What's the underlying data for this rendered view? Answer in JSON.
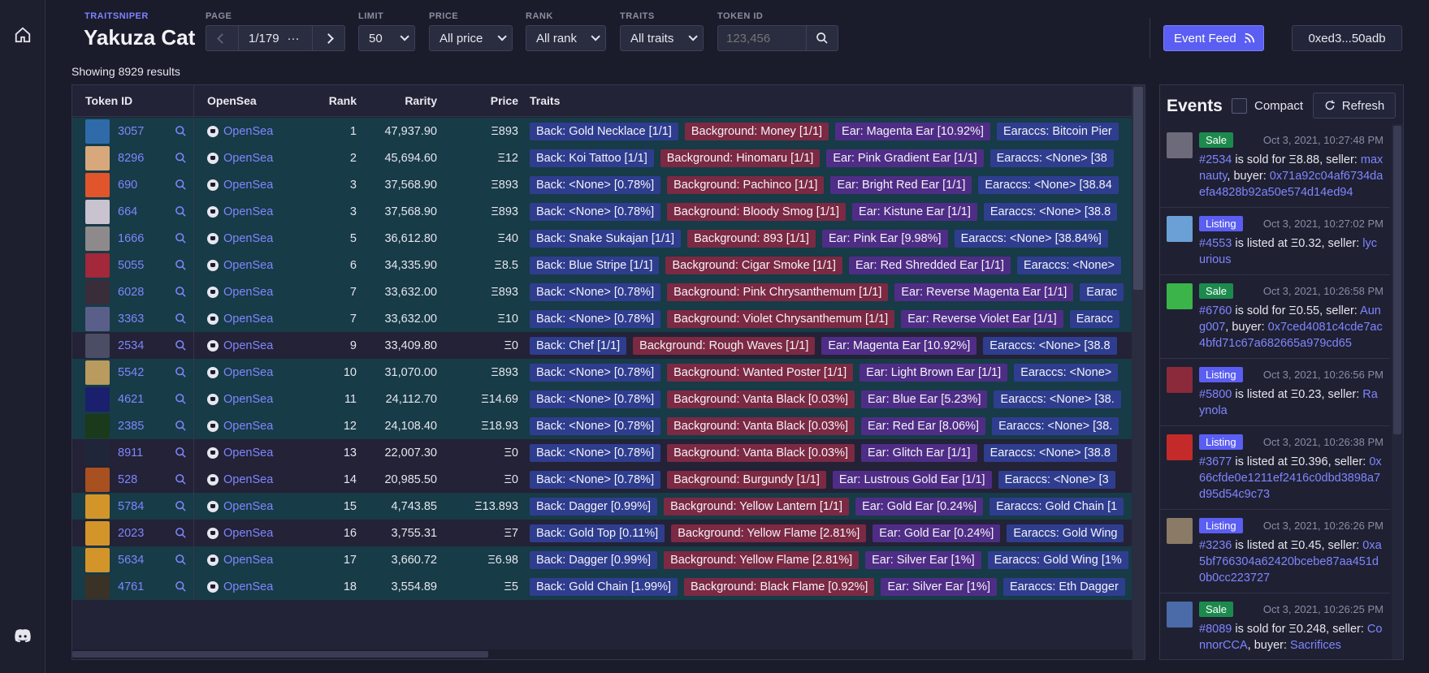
{
  "header": {
    "brand_sub": "TRAITSNIPER",
    "collection": "Yakuza Cat",
    "page_label": "PAGE",
    "page_value": "1/179",
    "page_more": "···",
    "limit_label": "LIMIT",
    "limit_value": "50",
    "price_label": "PRICE",
    "price_value": "All price",
    "rank_label": "RANK",
    "rank_value": "All rank",
    "traits_label": "TRAITS",
    "traits_value": "All traits",
    "token_label": "TOKEN ID",
    "token_placeholder": "123,456",
    "event_feed": "Event Feed",
    "wallet": "0xed3...50adb"
  },
  "results_text": "Showing 8929 results",
  "table": {
    "columns": [
      "Token ID",
      "OpenSea",
      "Rank",
      "Rarity",
      "Price",
      "Traits"
    ],
    "opensea_label": "OpenSea",
    "rows": [
      {
        "id": "3057",
        "rank": "1",
        "rarity": "47,937.90",
        "price": "Ξ893",
        "style": "teal",
        "thumb": "#2e6ba8",
        "traits": [
          "Back: Gold Necklace [1/1]",
          "Background: Money [1/1]",
          "Ear: Magenta Ear [10.92%]",
          "Earaccs: Bitcoin Pier"
        ]
      },
      {
        "id": "8296",
        "rank": "2",
        "rarity": "45,694.60",
        "price": "Ξ12",
        "style": "teal",
        "thumb": "#d7a87c",
        "traits": [
          "Back: Koi Tattoo [1/1]",
          "Background: Hinomaru [1/1]",
          "Ear: Pink Gradient Ear [1/1]",
          "Earaccs: <None> [38"
        ]
      },
      {
        "id": "690",
        "rank": "3",
        "rarity": "37,568.90",
        "price": "Ξ893",
        "style": "teal",
        "thumb": "#e0552b",
        "traits": [
          "Back: <None> [0.78%]",
          "Background: Pachinco [1/1]",
          "Ear: Bright Red Ear [1/1]",
          "Earaccs: <None> [38.84"
        ]
      },
      {
        "id": "664",
        "rank": "3",
        "rarity": "37,568.90",
        "price": "Ξ893",
        "style": "teal",
        "thumb": "#c9c2cf",
        "traits": [
          "Back: <None> [0.78%]",
          "Background: Bloody Smog [1/1]",
          "Ear: Kistune Ear [1/1]",
          "Earaccs: <None> [38.8"
        ]
      },
      {
        "id": "1666",
        "rank": "5",
        "rarity": "36,612.80",
        "price": "Ξ40",
        "style": "teal",
        "thumb": "#8e8a8c",
        "traits": [
          "Back: Snake Sukajan [1/1]",
          "Background: 893 [1/1]",
          "Ear: Pink Ear [9.98%]",
          "Earaccs: <None> [38.84%]"
        ]
      },
      {
        "id": "5055",
        "rank": "6",
        "rarity": "34,335.90",
        "price": "Ξ8.5",
        "style": "teal",
        "thumb": "#a2283a",
        "traits": [
          "Back: Blue Stripe [1/1]",
          "Background: Cigar Smoke [1/1]",
          "Ear: Red Shredded Ear [1/1]",
          "Earaccs: <None>"
        ]
      },
      {
        "id": "6028",
        "rank": "7",
        "rarity": "33,632.00",
        "price": "Ξ893",
        "style": "teal",
        "thumb": "#3a2d3a",
        "traits": [
          "Back: <None> [0.78%]",
          "Background: Pink Chrysanthemum [1/1]",
          "Ear: Reverse Magenta Ear [1/1]",
          "Earac"
        ]
      },
      {
        "id": "3363",
        "rank": "7",
        "rarity": "33,632.00",
        "price": "Ξ10",
        "style": "teal",
        "thumb": "#5a5f8a",
        "traits": [
          "Back: <None> [0.78%]",
          "Background: Violet Chrysanthemum [1/1]",
          "Ear: Reverse Violet Ear [1/1]",
          "Earacc"
        ]
      },
      {
        "id": "2534",
        "rank": "9",
        "rarity": "33,409.80",
        "price": "Ξ0",
        "style": "dark",
        "thumb": "#4a4d63",
        "traits": [
          "Back: Chef [1/1]",
          "Background: Rough Waves [1/1]",
          "Ear: Magenta Ear [10.92%]",
          "Earaccs: <None> [38.8"
        ]
      },
      {
        "id": "5542",
        "rank": "10",
        "rarity": "31,070.00",
        "price": "Ξ893",
        "style": "teal",
        "thumb": "#b99a5f",
        "traits": [
          "Back: <None> [0.78%]",
          "Background: Wanted Poster [1/1]",
          "Ear: Light Brown Ear [1/1]",
          "Earaccs: <None>"
        ]
      },
      {
        "id": "4621",
        "rank": "11",
        "rarity": "24,112.70",
        "price": "Ξ14.69",
        "style": "teal",
        "thumb": "#1a1f6e",
        "traits": [
          "Back: <None> [0.78%]",
          "Background: Vanta Black [0.03%]",
          "Ear: Blue Ear [5.23%]",
          "Earaccs: <None> [38."
        ]
      },
      {
        "id": "2385",
        "rank": "12",
        "rarity": "24,108.40",
        "price": "Ξ18.93",
        "style": "teal",
        "thumb": "#1b3a1b",
        "traits": [
          "Back: <None> [0.78%]",
          "Background: Vanta Black [0.03%]",
          "Ear: Red Ear [8.06%]",
          "Earaccs: <None> [38."
        ]
      },
      {
        "id": "8911",
        "rank": "13",
        "rarity": "22,007.30",
        "price": "Ξ0",
        "style": "dark",
        "thumb": "#20263a",
        "traits": [
          "Back: <None> [0.78%]",
          "Background: Vanta Black [0.03%]",
          "Ear: Glitch Ear [1/1]",
          "Earaccs: <None> [38.8"
        ]
      },
      {
        "id": "528",
        "rank": "14",
        "rarity": "20,985.50",
        "price": "Ξ0",
        "style": "dark",
        "thumb": "#a8501f",
        "traits": [
          "Back: <None> [0.78%]",
          "Background: Burgundy [1/1]",
          "Ear: Lustrous Gold Ear [1/1]",
          "Earaccs: <None> [3"
        ]
      },
      {
        "id": "5784",
        "rank": "15",
        "rarity": "4,743.85",
        "price": "Ξ13.893",
        "style": "teal",
        "thumb": "#d3952a",
        "traits": [
          "Back: Dagger [0.99%]",
          "Background: Yellow Lantern [1/1]",
          "Ear: Gold Ear [0.24%]",
          "Earaccs: Gold Chain [1"
        ]
      },
      {
        "id": "2023",
        "rank": "16",
        "rarity": "3,755.31",
        "price": "Ξ7",
        "style": "dark",
        "thumb": "#d3952a",
        "traits": [
          "Back: Gold Top [0.11%]",
          "Background: Yellow Flame [2.81%]",
          "Ear: Gold Ear [0.24%]",
          "Earaccs: Gold Wing"
        ]
      },
      {
        "id": "5634",
        "rank": "17",
        "rarity": "3,660.72",
        "price": "Ξ6.98",
        "style": "teal",
        "thumb": "#d3952a",
        "traits": [
          "Back: Dagger [0.99%]",
          "Background: Yellow Flame [2.81%]",
          "Ear: Silver Ear [1%]",
          "Earaccs: Gold Wing [1%"
        ]
      },
      {
        "id": "4761",
        "rank": "18",
        "rarity": "3,554.89",
        "price": "Ξ5",
        "style": "teal",
        "thumb": "#3a3226",
        "traits": [
          "Back: Gold Chain [1.99%]",
          "Background: Black Flame [0.92%]",
          "Ear: Silver Ear [1%]",
          "Earaccs: Eth Dagger"
        ]
      }
    ]
  },
  "events": {
    "title": "Events",
    "compact_label": "Compact",
    "refresh_label": "Refresh",
    "items": [
      {
        "type": "Sale",
        "time": "Oct 3, 2021, 10:27:48 PM",
        "thumb": "#6d6a7a",
        "token": "#2534",
        "mid": " is sold for Ξ8.88, seller: ",
        "seller": "maxnauty",
        "buyer_prefix": ", buyer: ",
        "buyer": "0x71a92c04af6734daefa4828b92a50e574d14ed94"
      },
      {
        "type": "Listing",
        "time": "Oct 3, 2021, 10:27:02 PM",
        "thumb": "#6aa0d6",
        "token": "#4553",
        "mid": " is listed at Ξ0.32, seller: ",
        "seller": "lycurious",
        "buyer_prefix": "",
        "buyer": ""
      },
      {
        "type": "Sale",
        "time": "Oct 3, 2021, 10:26:58 PM",
        "thumb": "#3bb54a",
        "token": "#6760",
        "mid": " is sold for Ξ0.55, seller: ",
        "seller": "Aung007",
        "buyer_prefix": ", buyer: ",
        "buyer": "0x7ced4081c4cde7ac4bfd71c67a682665a979cd65"
      },
      {
        "type": "Listing",
        "time": "Oct 3, 2021, 10:26:56 PM",
        "thumb": "#8a2a3a",
        "token": "#5800",
        "mid": " is listed at Ξ0.23, seller: ",
        "seller": "Raynola",
        "buyer_prefix": "",
        "buyer": ""
      },
      {
        "type": "Listing",
        "time": "Oct 3, 2021, 10:26:38 PM",
        "thumb": "#c42a2a",
        "token": "#3677",
        "mid": " is listed at Ξ0.396, seller: ",
        "seller": "0x66cfde0e1211ef2416c0dbd3898a7d95d54c9c73",
        "buyer_prefix": "",
        "buyer": ""
      },
      {
        "type": "Listing",
        "time": "Oct 3, 2021, 10:26:26 PM",
        "thumb": "#8a7a66",
        "token": "#3236",
        "mid": " is listed at Ξ0.45, seller: ",
        "seller": "0xa5bf766304a62420bcebe87aa451d0b0cc223727",
        "buyer_prefix": "",
        "buyer": ""
      },
      {
        "type": "Sale",
        "time": "Oct 3, 2021, 10:26:25 PM",
        "thumb": "#4a6aa8",
        "token": "#8089",
        "mid": " is sold for Ξ0.248, seller: ",
        "seller": "ConnorCCA",
        "buyer_prefix": ", buyer: ",
        "buyer": "Sacrifices"
      }
    ]
  }
}
